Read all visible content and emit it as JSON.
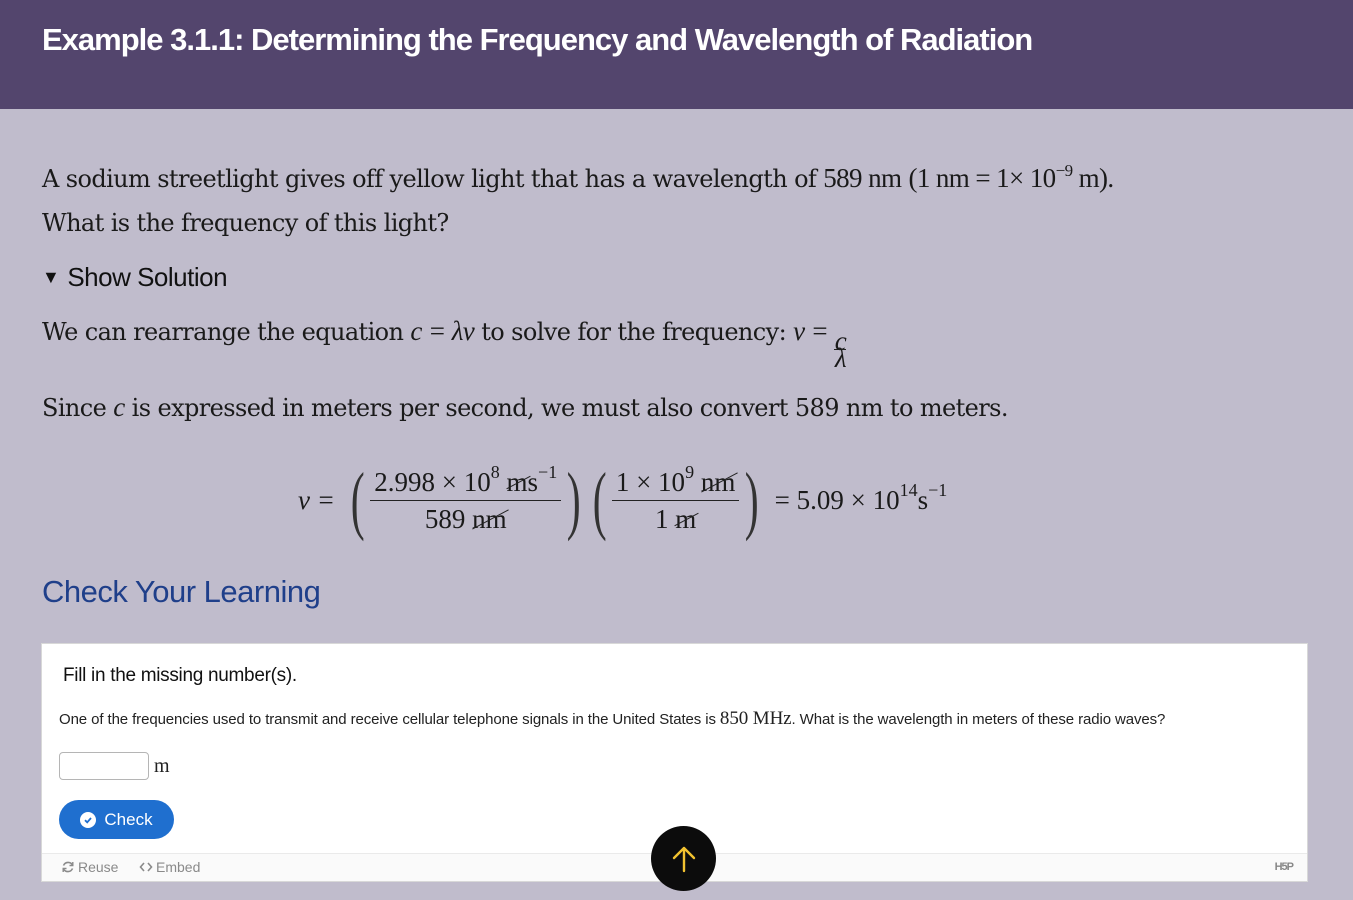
{
  "header": {
    "title": "Example 3.1.1: Determining the Frequency and Wavelength of Radiation"
  },
  "problem": {
    "text_1": "A sodium streetlight gives off yellow light that has a wavelength of ",
    "wavelength": "589 nm",
    "conv_open": "(1 nm = 1× 10",
    "conv_exp": "−9",
    "conv_close": " m).",
    "text_2": "What is the frequency of this light?"
  },
  "solution_toggle": {
    "icon": "triangle-down",
    "glyph": "▼",
    "label": "Show Solution"
  },
  "solution": {
    "line1_prefix": "We can rearrange the equation ",
    "line1_eq": "c = λν",
    "line1_mid": " to solve for the frequency: ",
    "line1_eq2": "ν = ",
    "line1_frac_num": "c",
    "line1_frac_den": "λ",
    "line2_prefix": "Since ",
    "line2_var": "c",
    "line2_suffix": " is expressed in meters per second, we must also convert 589 nm to meters.",
    "equation": {
      "lhs": "ν =",
      "frac1_num_coeff": "2.998 × 10",
      "frac1_num_exp": "8",
      "frac1_num_unit_cancel": "m",
      "frac1_num_unit": "s",
      "frac1_num_unit_exp": "−1",
      "frac1_den_coeff": "589 ",
      "frac1_den_cancel": "nm",
      "frac2_num_coeff": "1 × 10",
      "frac2_num_exp": "9",
      "frac2_num_cancel": "nm",
      "frac2_den_coeff": "1 ",
      "frac2_den_cancel": "m",
      "result_prefix": "= 5.09 × 10",
      "result_exp": "14",
      "result_unit": "s",
      "result_unit_exp": "−1"
    }
  },
  "check_your_learning": {
    "heading": "Check Your Learning",
    "instruction": "Fill in the missing number(s).",
    "question_1": "One of the frequencies used to transmit and receive cellular telephone signals in the United States is ",
    "question_value": "850 MHz",
    "question_2": ". What is the wavelength in meters of these radio waves?",
    "answer_value": "",
    "answer_placeholder": "",
    "unit": "m",
    "check_label": "Check",
    "footer": {
      "reuse_label": "Reuse",
      "embed_label": "Embed",
      "brand": "H5P"
    }
  },
  "back_to_top": {
    "icon": "arrow-up",
    "color": "#f2c230"
  },
  "colors": {
    "header_bg": "#53456d",
    "page_bg": "#c0bccc",
    "heading_blue": "#1f3f8a",
    "button_blue": "#1f6fcf"
  }
}
